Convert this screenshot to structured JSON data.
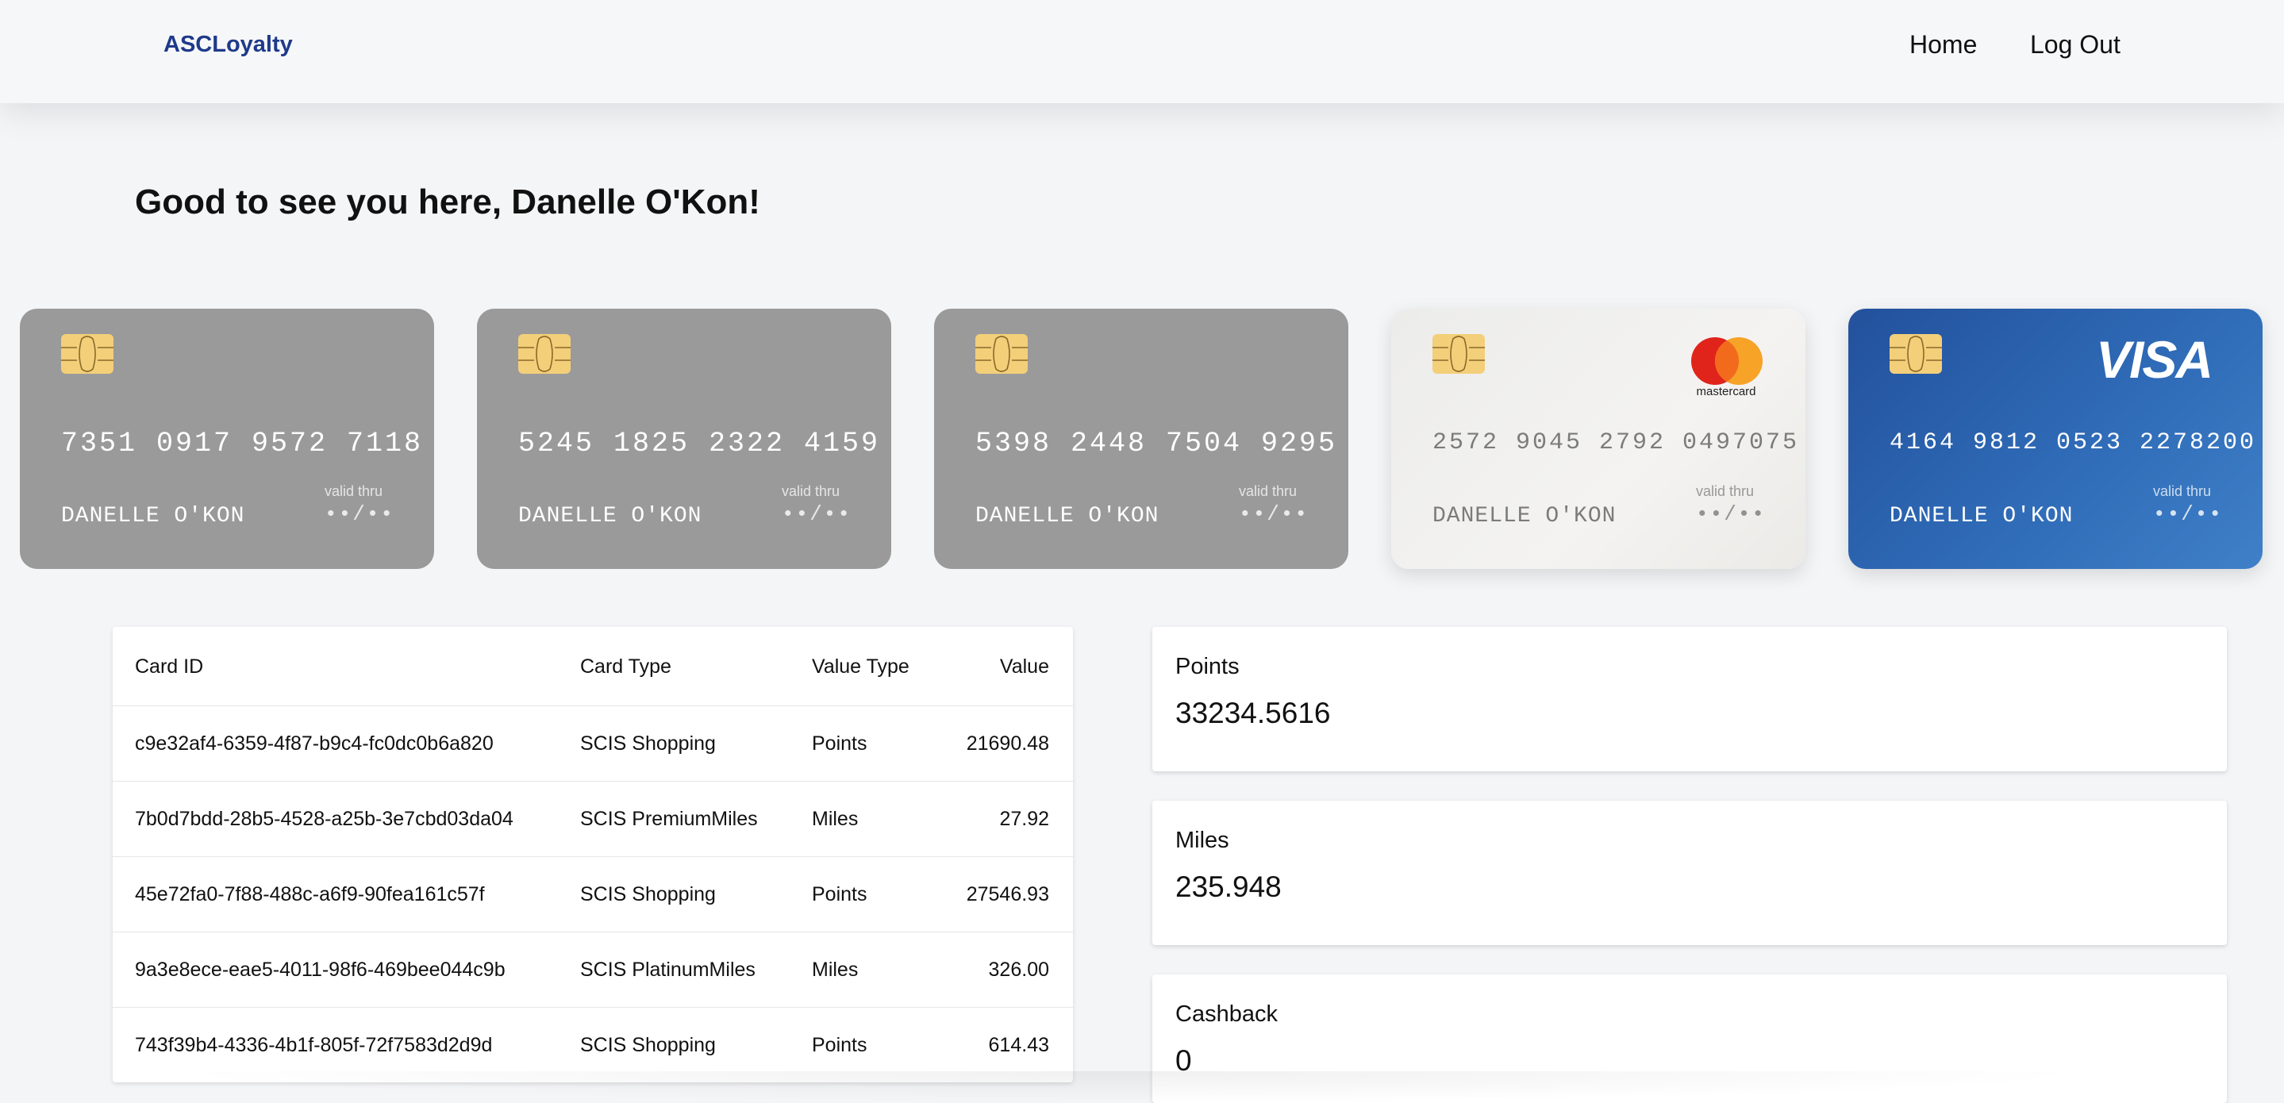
{
  "header": {
    "brand": "ASCLoyalty",
    "nav": {
      "home": "Home",
      "logout": "Log Out"
    }
  },
  "greeting": "Good to see you here, Danelle O'Kon!",
  "cards": [
    {
      "number": "7351 0917 9572 7118",
      "holder": "DANELLE O'KON",
      "valid_label": "valid thru",
      "valid_value": "••/••",
      "style": "gray",
      "brand_icon": "none"
    },
    {
      "number": "5245 1825 2322 4159",
      "holder": "DANELLE O'KON",
      "valid_label": "valid thru",
      "valid_value": "••/••",
      "style": "gray",
      "brand_icon": "none"
    },
    {
      "number": "5398 2448 7504 9295",
      "holder": "DANELLE O'KON",
      "valid_label": "valid thru",
      "valid_value": "••/••",
      "style": "gray",
      "brand_icon": "none"
    },
    {
      "number": "2572 9045 2792 0497075",
      "holder": "DANELLE O'KON",
      "valid_label": "valid thru",
      "valid_value": "••/••",
      "style": "white",
      "brand_icon": "mastercard-logo",
      "brand_text": "mastercard"
    },
    {
      "number": "4164 9812 0523 2278200",
      "holder": "DANELLE O'KON",
      "valid_label": "valid thru",
      "valid_value": "••/••",
      "style": "blue",
      "brand_icon": "visa-logo",
      "brand_text": "VISA"
    }
  ],
  "table": {
    "headers": {
      "card_id": "Card ID",
      "card_type": "Card Type",
      "value_type": "Value Type",
      "value": "Value"
    },
    "rows": [
      {
        "card_id": "c9e32af4-6359-4f87-b9c4-fc0dc0b6a820",
        "card_type": "SCIS Shopping",
        "value_type": "Points",
        "value": "21690.48"
      },
      {
        "card_id": "7b0d7bdd-28b5-4528-a25b-3e7cbd03da04",
        "card_type": "SCIS PremiumMiles",
        "value_type": "Miles",
        "value": "27.92"
      },
      {
        "card_id": "45e72fa0-7f88-488c-a6f9-90fea161c57f",
        "card_type": "SCIS Shopping",
        "value_type": "Points",
        "value": "27546.93"
      },
      {
        "card_id": "9a3e8ece-eae5-4011-98f6-469bee044c9b",
        "card_type": "SCIS PlatinumMiles",
        "value_type": "Miles",
        "value": "326.00"
      },
      {
        "card_id": "743f39b4-4336-4b1f-805f-72f7583d2d9d",
        "card_type": "SCIS Shopping",
        "value_type": "Points",
        "value": "614.43"
      }
    ]
  },
  "summary": {
    "points": {
      "label": "Points",
      "value": "33234.5616"
    },
    "miles": {
      "label": "Miles",
      "value": "235.948"
    },
    "cashback": {
      "label": "Cashback",
      "value": "0"
    }
  },
  "colors": {
    "brand": "#1e3a8a",
    "card_gray": "#9a9a9a",
    "card_blue": "#2f6bb7",
    "chip": "#f3cf7a"
  }
}
